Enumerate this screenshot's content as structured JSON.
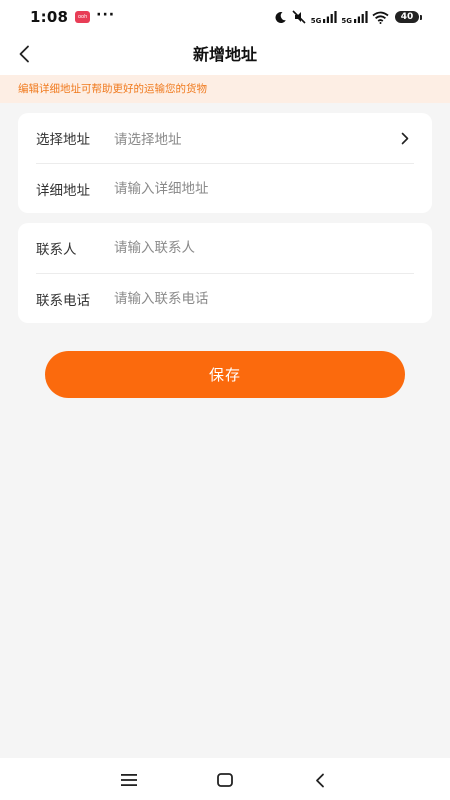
{
  "status_bar": {
    "time": "1:08",
    "app_icon_text": "ooh",
    "more_dots": "···",
    "signal_label_1": "5G",
    "signal_label_2": "5G",
    "battery_level": "40"
  },
  "header": {
    "title": "新增地址",
    "back_icon": "chevron-left-icon"
  },
  "notice": {
    "text": "编辑详细地址可帮助更好的运输您的货物"
  },
  "address_card": {
    "select_address_label": "选择地址",
    "select_address_placeholder": "请选择地址",
    "detail_address_label": "详细地址",
    "detail_address_placeholder": "请输入详细地址"
  },
  "contact_card": {
    "contact_label": "联系人",
    "contact_placeholder": "请输入联系人",
    "phone_label": "联系电话",
    "phone_placeholder": "请输入联系电话"
  },
  "actions": {
    "save_label": "保存"
  },
  "colors": {
    "accent": "#fb6a0d",
    "notice_bg": "#fdeee4",
    "notice_text": "#f07a1e",
    "page_bg": "#f5f5f5"
  },
  "nav_bar": {
    "icons": [
      "menu-icon",
      "home-icon",
      "back-icon"
    ]
  }
}
